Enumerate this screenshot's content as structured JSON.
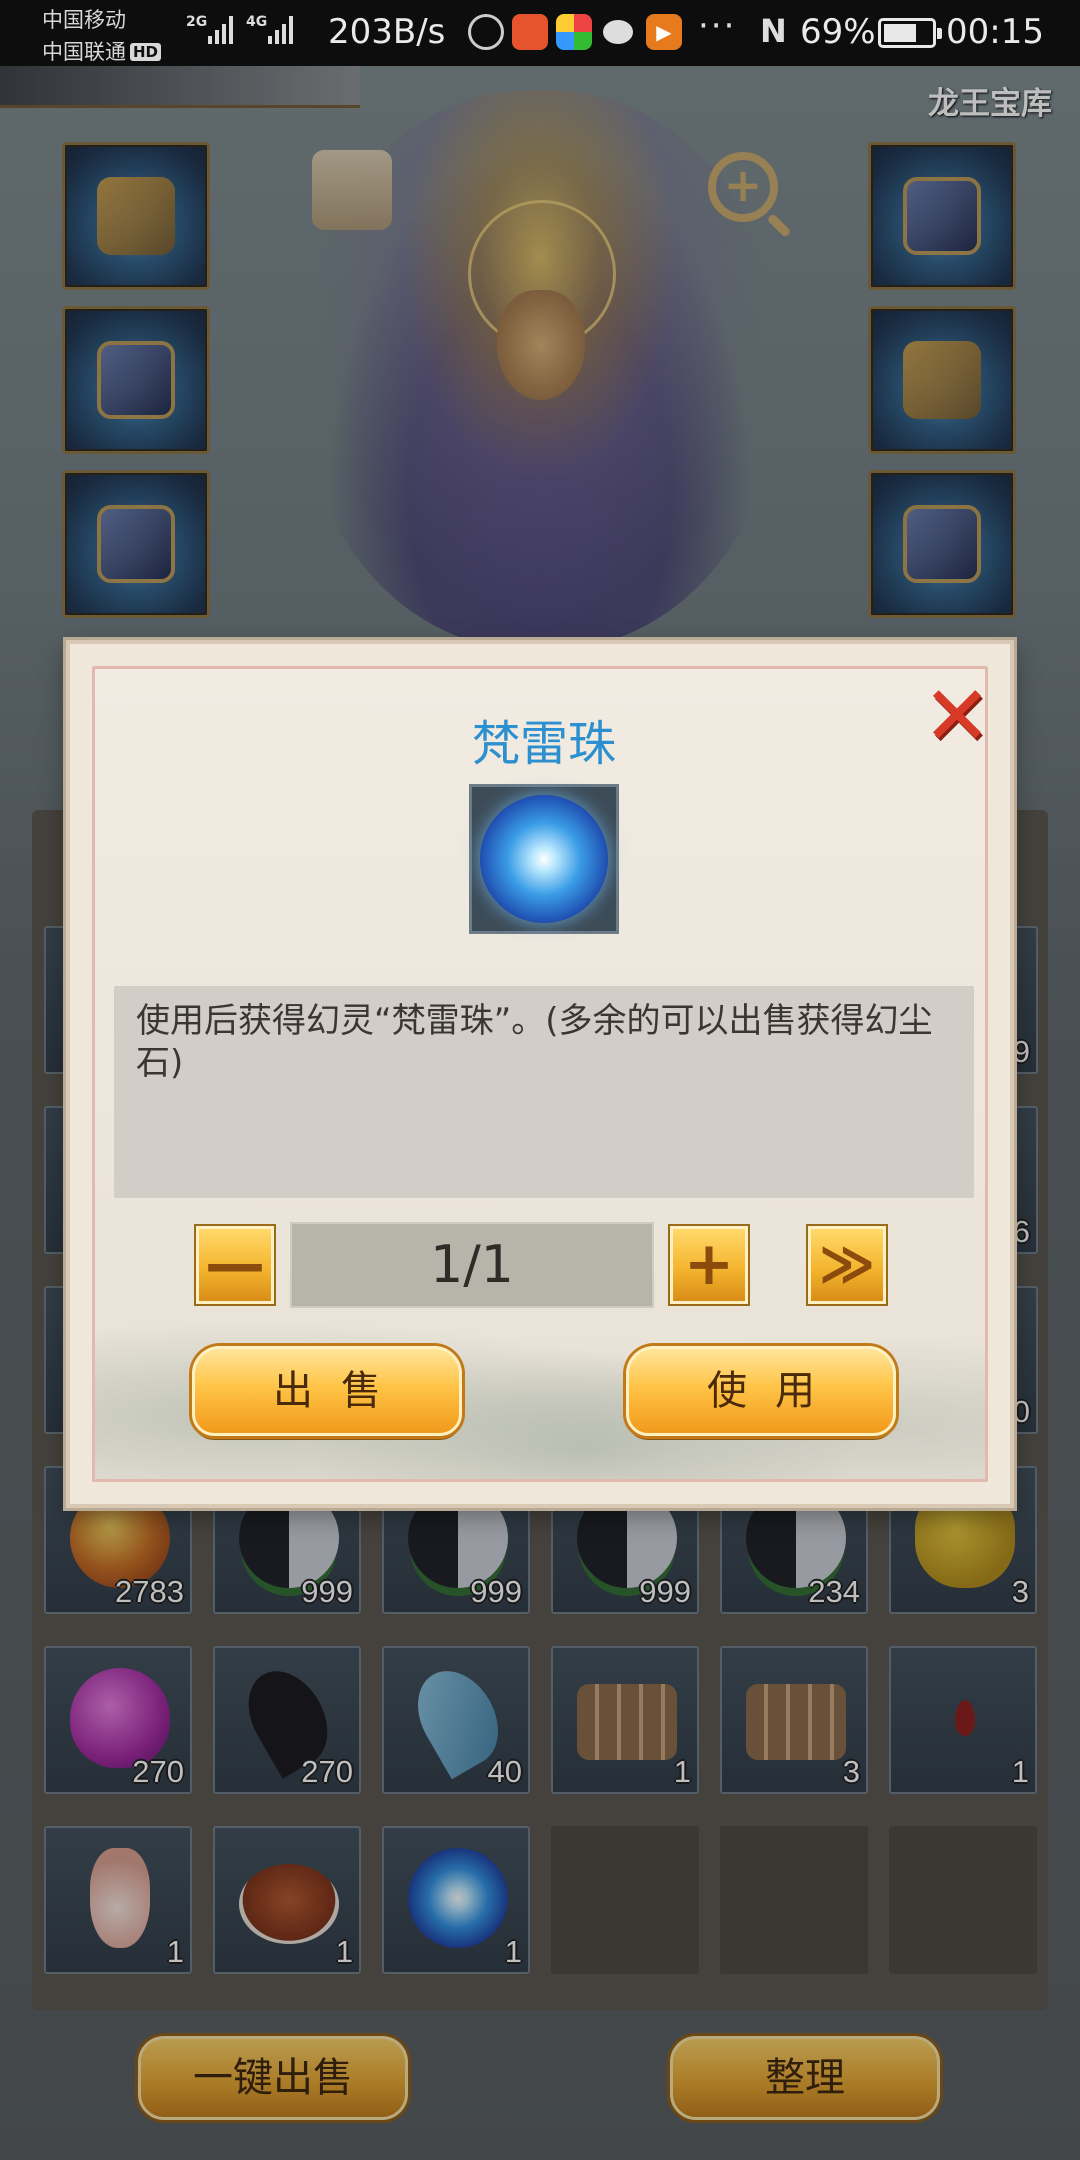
{
  "status_bar": {
    "carrier_1": "中国移动",
    "carrier_2": "中国联通",
    "carrier_2_badge": "HD",
    "signal_1_type": "2G",
    "signal_2_type": "4G",
    "net_speed": "203B/s",
    "more": "···",
    "nfc": "N",
    "battery": "69%",
    "battery_level": 0.69,
    "time": "00:15",
    "icons": [
      "browser-icon",
      "app-icon",
      "colorful-app-icon",
      "wechat-icon",
      "video-app-icon"
    ]
  },
  "scene": {
    "vault_label": "龙王宝库",
    "equip_left": [
      "weapon-icon",
      "helmet-icon",
      "armor-icon"
    ],
    "equip_right": [
      "ring-icon",
      "dragon-amulet-icon",
      "bracer-icon"
    ]
  },
  "inventory": {
    "rows": [
      [
        {
          "icon": "flame-orb-icon",
          "count": "2783"
        },
        {
          "icon": "yin-yang-icon",
          "count": "999"
        },
        {
          "icon": "yin-yang-icon",
          "count": "999"
        },
        {
          "icon": "yin-yang-icon",
          "count": "999"
        },
        {
          "icon": "yin-yang-icon",
          "count": "234"
        },
        {
          "icon": "pepper-icon",
          "count": "3"
        }
      ],
      [
        {
          "icon": "purple-egg-icon",
          "count": "270"
        },
        {
          "icon": "dark-tomoe-icon",
          "count": "270"
        },
        {
          "icon": "blue-tomoe-icon",
          "count": "40"
        },
        {
          "icon": "logs-icon",
          "count": "1"
        },
        {
          "icon": "logs-icon",
          "count": "3"
        },
        {
          "icon": "blood-drop-icon",
          "count": "1"
        }
      ],
      [
        {
          "icon": "potion-bottle-icon",
          "count": "1"
        },
        {
          "icon": "roast-duck-icon",
          "count": "1"
        },
        {
          "icon": "thunder-orb-icon",
          "count": "1"
        }
      ]
    ],
    "peek_counts": [
      "9",
      "6",
      "0"
    ]
  },
  "dialog": {
    "title": "梵雷珠",
    "close_glyph": "✕",
    "item_icon": "thunder-orb-icon",
    "description": "使用后获得幻灵“梵雷珠”。(多余的可以出售获得幻尘石)",
    "quantity": "1/1",
    "minus": "—",
    "plus": "+",
    "max": "≫",
    "sell_label": "出售",
    "use_label": "使用"
  },
  "footer": {
    "sell_all_label": "一键出售",
    "sort_label": "整理"
  }
}
